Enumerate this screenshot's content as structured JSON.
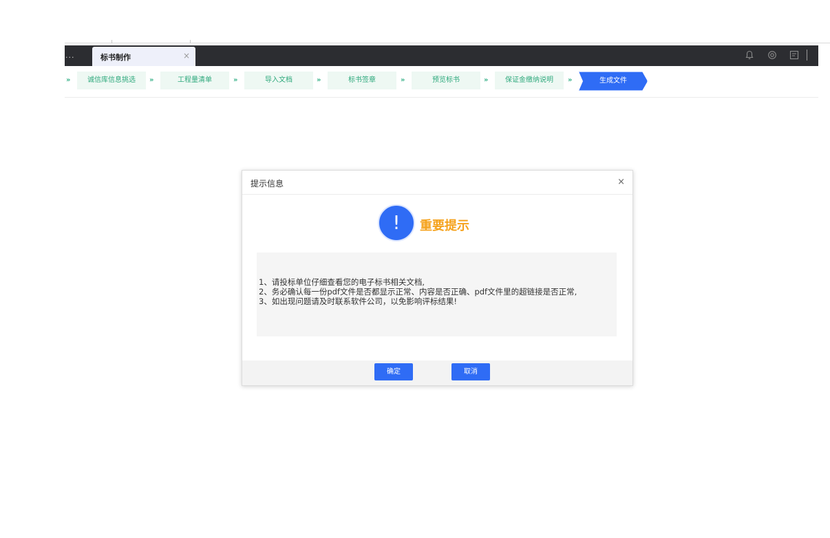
{
  "tabs": {
    "ellipsis": "...",
    "active_label": "标书制作",
    "close_glyph": "×"
  },
  "toolbar": {
    "icons": [
      "bell-icon",
      "settings-icon",
      "window-icon"
    ]
  },
  "steps": {
    "arrow_glyph": "»",
    "items": [
      {
        "label": "诚信库信息挑选",
        "active": false
      },
      {
        "label": "工程量清单",
        "active": false
      },
      {
        "label": "导入文档",
        "active": false
      },
      {
        "label": "标书签章",
        "active": false
      },
      {
        "label": "预览标书",
        "active": false
      },
      {
        "label": "保证金缴纳说明",
        "active": false
      },
      {
        "label": "生成文件",
        "active": true
      }
    ]
  },
  "dialog": {
    "title": "提示信息",
    "close_glyph": "×",
    "alert_glyph": "!",
    "alert_title": "重要提示",
    "lines": [
      "1、请投标单位仔细查看您的电子标书相关文档,",
      "2、务必确认每一份pdf文件是否都显示正常、内容是否正确、pdf文件里的超链接是否正常,",
      "3、如出现问题请及时联系软件公司，以免影响评标结果!"
    ],
    "confirm_label": "确定",
    "cancel_label": "取消"
  },
  "colors": {
    "accent": "#2f6cf5",
    "step_text": "#2fa97d",
    "warning": "#f5a21c",
    "tabbar": "#2c2d31"
  }
}
